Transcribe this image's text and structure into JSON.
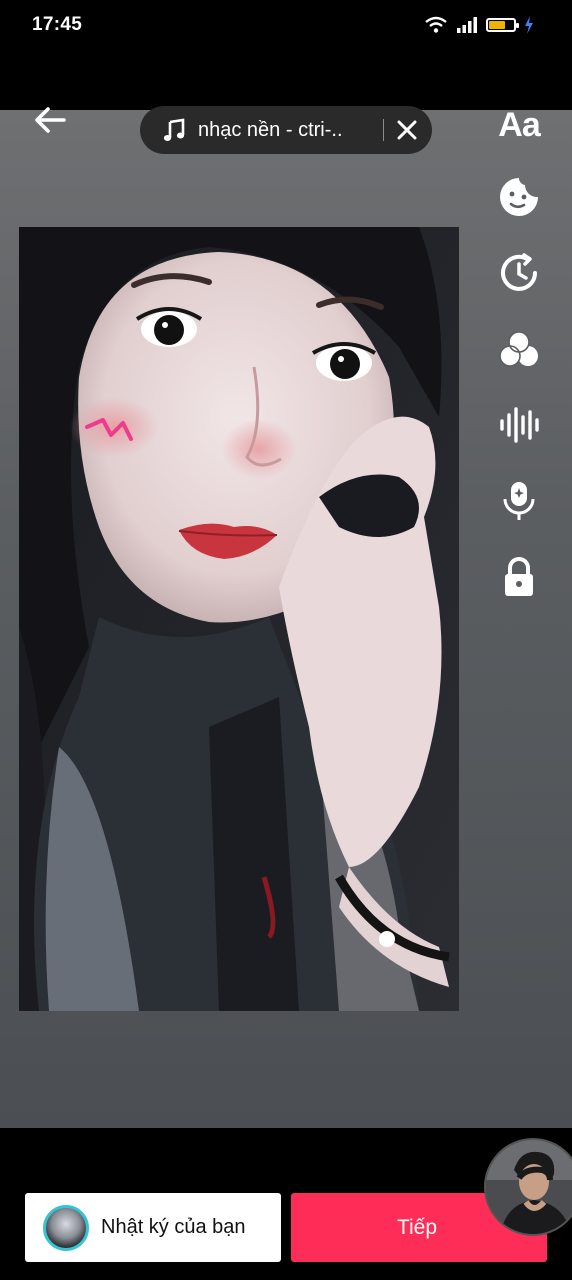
{
  "status_bar": {
    "time": "17:45"
  },
  "header": {
    "music_label": "nhạc nền - ctri-..",
    "text_tool_label": "Aa"
  },
  "tools": [
    "text-tool",
    "sticker-tool",
    "timer-tool",
    "effects-tool",
    "voice-effects-tool",
    "voiceover-tool",
    "privacy-tool"
  ],
  "bottom": {
    "diary_label": "Nhật ký của bạn",
    "next_label": "Tiếp"
  },
  "colors": {
    "accent": "#fd2d57",
    "battery": "#f0b400",
    "avatar_ring": "#36c4d4"
  }
}
